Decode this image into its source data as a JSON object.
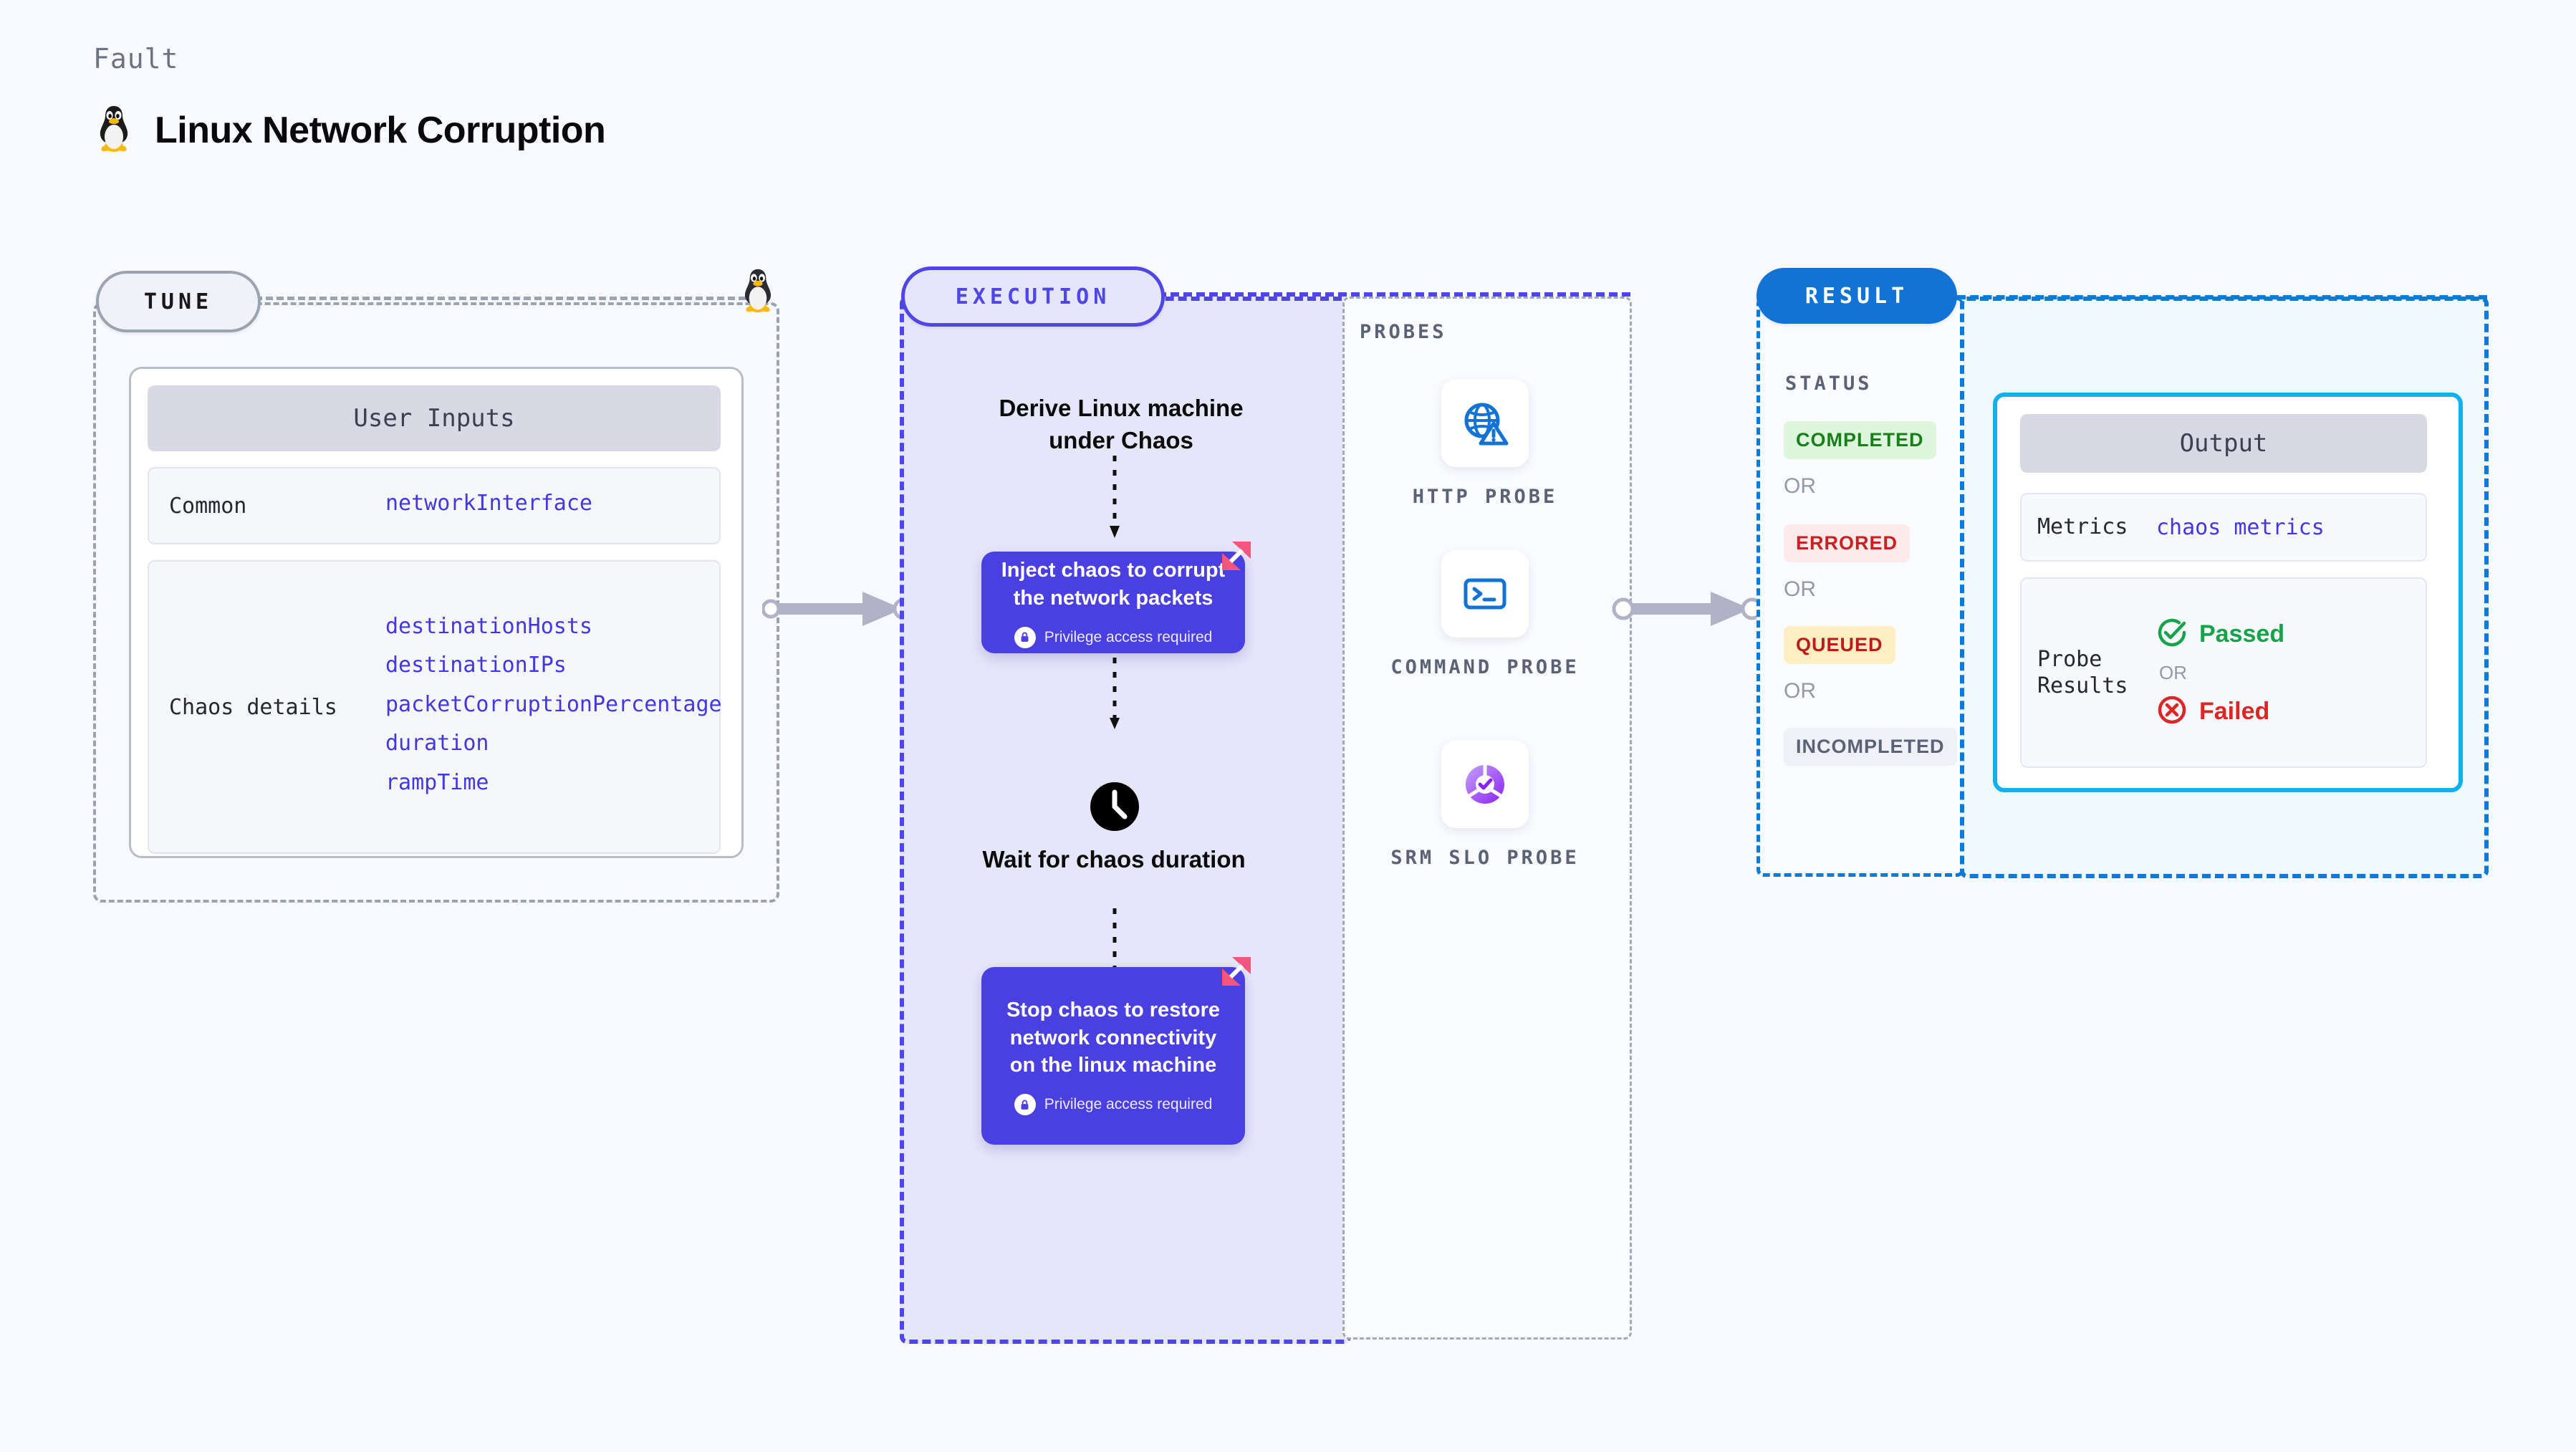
{
  "header": {
    "kicker": "Fault",
    "title": "Linux Network Corruption",
    "icon": "linux-tux-icon"
  },
  "tune": {
    "pill_label": "TUNE",
    "card_title": "User Inputs",
    "rows": [
      {
        "key": "Common",
        "values": [
          "networkInterface"
        ]
      },
      {
        "key": "Chaos details",
        "values": [
          "destinationHosts",
          "destinationIPs",
          "packetCorruptionPercentage",
          "duration",
          "rampTime"
        ]
      }
    ]
  },
  "execution": {
    "pill_label": "EXECUTION",
    "steps": [
      {
        "type": "label",
        "text": "Derive Linux machine under Chaos"
      },
      {
        "type": "action",
        "text": "Inject chaos to corrupt the network packets",
        "privilege": "Privilege access required"
      },
      {
        "type": "label",
        "icon": "clock-icon",
        "text": "Wait for chaos duration"
      },
      {
        "type": "action",
        "text": "Stop chaos to restore network connectivity on the linux machine",
        "privilege": "Privilege access required"
      }
    ]
  },
  "probes": {
    "title": "PROBES",
    "items": [
      {
        "name": "HTTP PROBE",
        "icon": "globe-warning-icon"
      },
      {
        "name": "COMMAND PROBE",
        "icon": "terminal-icon"
      },
      {
        "name": "SRM SLO PROBE",
        "icon": "slo-donut-check-icon"
      }
    ]
  },
  "result": {
    "pill_label": "RESULT",
    "status_title": "STATUS",
    "or_label": "OR",
    "statuses": [
      {
        "label": "COMPLETED",
        "color": "#198019",
        "bg": "#ddf6dd"
      },
      {
        "label": "ERRORED",
        "color": "#cc1f1f",
        "bg": "#fdeaea"
      },
      {
        "label": "QUEUED",
        "color": "#bb1b1b",
        "bg": "#fdeec4"
      },
      {
        "label": "INCOMPLETED",
        "color": "#5b6275",
        "bg": "#f0f1f7"
      }
    ]
  },
  "output": {
    "card_title": "Output",
    "metrics_key": "Metrics",
    "metrics_value": "chaos metrics",
    "probe_results_key": "Probe Results",
    "passed_label": "Passed",
    "failed_label": "Failed",
    "or_label": "OR"
  },
  "colors": {
    "accent_purple": "#4f46e5",
    "accent_blue": "#1273d4",
    "cyan": "#12b0ef",
    "pink": "#f4557f",
    "gray_dash": "#9ca3b0"
  }
}
